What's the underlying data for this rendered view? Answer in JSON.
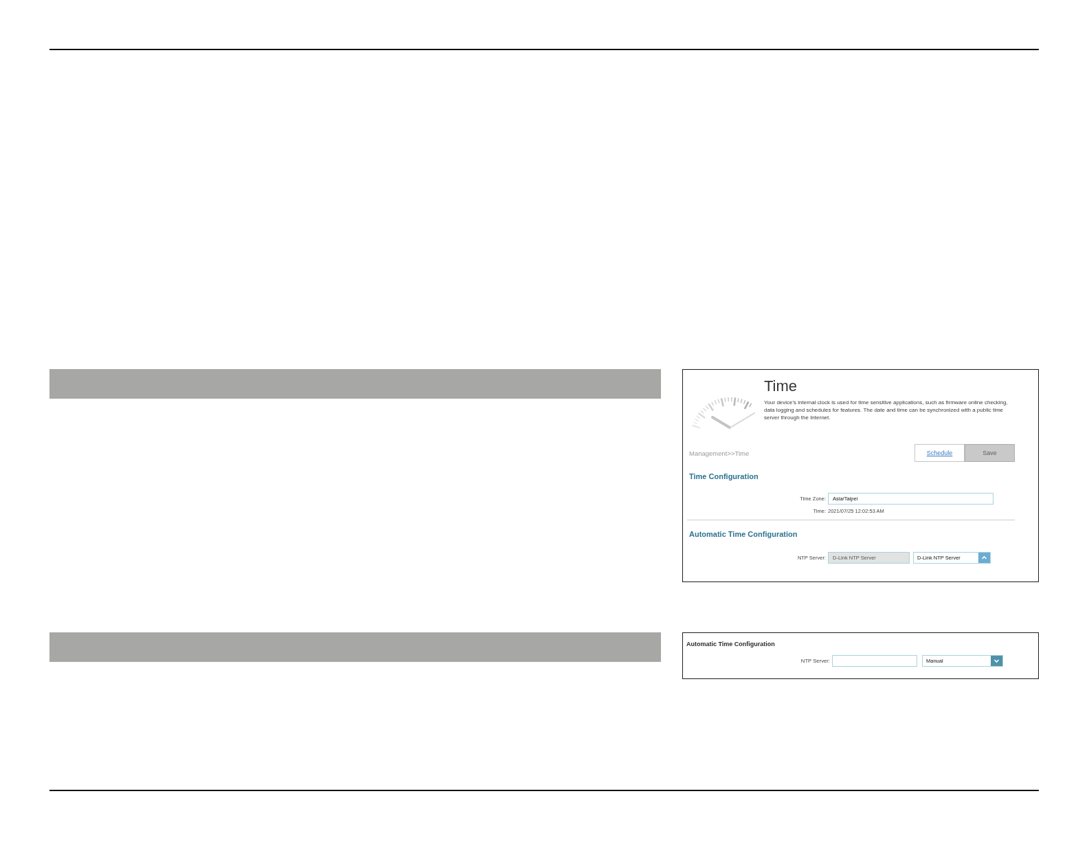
{
  "sections": [
    {
      "kind": "full",
      "panel": {
        "title": "Time",
        "description": "Your device's internal clock is used for time sensitive applications, such as firmware online checking, data logging and schedules for features. The date and time can be synchronized with a public time server through the Internet.",
        "breadcrumb": "Management>>Time",
        "buttons": [
          {
            "label": "Schedule",
            "disabled": false
          },
          {
            "label": "Save",
            "disabled": true
          }
        ],
        "time_configuration": {
          "heading": "Time Configuration",
          "time_zone": {
            "label": "Time Zone:",
            "value": "Asia/Taipei"
          },
          "time": {
            "label": "Time:",
            "value": "2021/07/25 12:02:53 AM"
          }
        },
        "automatic_time_configuration": {
          "heading": "Automatic Time Configuration",
          "ntp_server": {
            "label": "NTP Server:",
            "value": "D-Link NTP Server",
            "disabled": true
          },
          "dropdown": {
            "value": "D-Link NTP Server",
            "expanded": true
          }
        }
      }
    },
    {
      "kind": "excerpt",
      "panel": {
        "automatic_time_configuration": {
          "heading": "Automatic Time Configuration",
          "ntp_server": {
            "label": "NTP Server:",
            "disabled": false
          },
          "dropdown": {
            "value": "Manual",
            "expanded": false
          }
        }
      }
    }
  ]
}
